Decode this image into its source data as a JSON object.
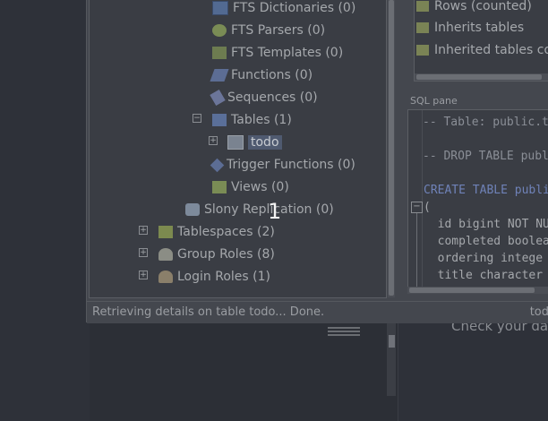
{
  "tree": {
    "items": [
      {
        "label": "FTS Dictionaries (0)",
        "icon": "fts-dictionary-icon"
      },
      {
        "label": "FTS Parsers (0)",
        "icon": "fts-parser-icon"
      },
      {
        "label": "FTS Templates (0)",
        "icon": "fts-template-icon"
      },
      {
        "label": "Functions (0)",
        "icon": "function-icon"
      },
      {
        "label": "Sequences (0)",
        "icon": "sequence-icon"
      },
      {
        "label": "Tables (1)",
        "icon": "tables-icon",
        "expander": "−"
      },
      {
        "label": "todo",
        "icon": "table-icon",
        "expander": "+",
        "selected": true
      },
      {
        "label": "Trigger Functions (0)",
        "icon": "trigger-function-icon"
      },
      {
        "label": "Views (0)",
        "icon": "view-icon"
      },
      {
        "label": "Slony Replication (0)",
        "icon": "slony-icon"
      },
      {
        "label": "Tablespaces (2)",
        "icon": "tablespace-icon",
        "expander": "+"
      },
      {
        "label": "Group Roles (8)",
        "icon": "group-role-icon",
        "expander": "+"
      },
      {
        "label": "Login Roles (1)",
        "icon": "login-role-icon",
        "expander": "+"
      }
    ]
  },
  "properties": {
    "rows": [
      "Rows (counted)",
      "Inherits tables",
      "Inherited tables cou"
    ]
  },
  "sql_pane": {
    "label": "SQL pane",
    "fold_symbol": "−",
    "lines": [
      "-- Table: public.t",
      "",
      "-- DROP TABLE publ",
      "",
      "CREATE TABLE publi",
      "(",
      "  id bigint NOT NU",
      "  completed boolea",
      "  ordering intege",
      "  title character"
    ]
  },
  "status": {
    "left": "Retrieving details on table todo... Done.",
    "right": "tod"
  },
  "background": {
    "text": "Check your da"
  },
  "overlay": {
    "number": "1"
  },
  "colors": {
    "selection": "#4f5a70",
    "keyword": "#6f82b8",
    "comment": "#8a8e96"
  }
}
